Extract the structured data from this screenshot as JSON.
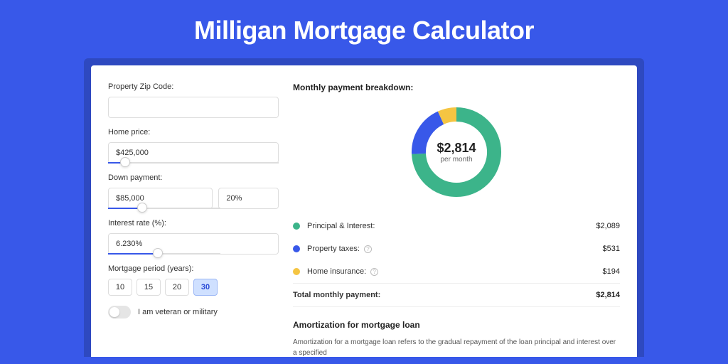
{
  "title": "Milligan Mortgage Calculator",
  "colors": {
    "principal": "#3cb48a",
    "taxes": "#3858e9",
    "insurance": "#f5c542"
  },
  "left": {
    "zip_label": "Property Zip Code:",
    "zip_value": "",
    "home_price_label": "Home price:",
    "home_price_value": "$425,000",
    "home_price_slider_pct": 10,
    "down_payment_label": "Down payment:",
    "down_payment_value": "$85,000",
    "down_payment_pct": "20%",
    "down_payment_slider_pct": 30,
    "interest_label": "Interest rate (%):",
    "interest_value": "6.230%",
    "interest_slider_pct": 44,
    "period_label": "Mortgage period (years):",
    "periods": [
      "10",
      "15",
      "20",
      "30"
    ],
    "period_active": "30",
    "veteran_label": "I am veteran or military"
  },
  "right": {
    "breakdown_title": "Monthly payment breakdown:",
    "center_value": "$2,814",
    "center_sub": "per month",
    "rows": [
      {
        "label": "Principal & Interest:",
        "value": "$2,089",
        "info": false
      },
      {
        "label": "Property taxes:",
        "value": "$531",
        "info": true
      },
      {
        "label": "Home insurance:",
        "value": "$194",
        "info": true
      }
    ],
    "total_label": "Total monthly payment:",
    "total_value": "$2,814",
    "amort_title": "Amortization for mortgage loan",
    "amort_text": "Amortization for a mortgage loan refers to the gradual repayment of the loan principal and interest over a specified"
  },
  "chart_data": {
    "type": "pie",
    "title": "Monthly payment breakdown",
    "series": [
      {
        "name": "Principal & Interest",
        "value": 2089,
        "color": "#3cb48a"
      },
      {
        "name": "Property taxes",
        "value": 531,
        "color": "#3858e9"
      },
      {
        "name": "Home insurance",
        "value": 194,
        "color": "#f5c542"
      }
    ],
    "total": 2814,
    "center_label": "$2,814 per month"
  }
}
